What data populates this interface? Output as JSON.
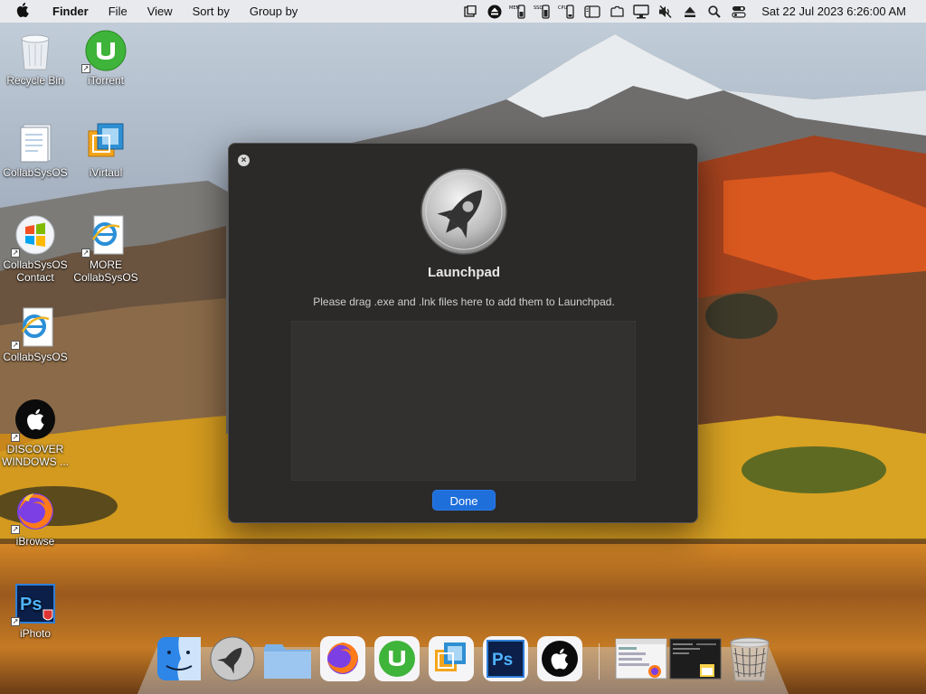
{
  "menubar": {
    "app_name": "Finder",
    "menus": [
      "File",
      "View",
      "Sort by",
      "Group by"
    ],
    "status_icons": [
      "task-manager-icon",
      "eject-disk-icon",
      "ram-meter-icon",
      "ssd-meter-icon",
      "cpu-meter-icon",
      "sidebar-icon",
      "cloud-icon",
      "display-icon",
      "mute-icon",
      "eject-icon",
      "search-icon",
      "control-center-icon"
    ],
    "status_labels": {
      "mem": "MEM",
      "ssd": "SSD",
      "cpu": "CPU"
    },
    "clock": "Sat 22 Jul 2023  6:26:00 AM"
  },
  "desktop": {
    "icons": [
      {
        "label": "Recycle Bin",
        "icon": "recycle-bin-icon"
      },
      {
        "label": "iTorrent",
        "icon": "utorrent-icon"
      },
      {
        "label": "CollabSysOS",
        "icon": "folder-doc-icon"
      },
      {
        "label": "iVirtaul",
        "icon": "virtual-machine-icon"
      },
      {
        "label": "CollabSysOS Contact",
        "icon": "windows-logo-icon"
      },
      {
        "label": "MORE CollabSysOS",
        "icon": "ie-document-icon"
      },
      {
        "label": "CollabSysOS",
        "icon": "ie-document-icon"
      },
      {
        "label": "DISCOVER WINDOWS ...",
        "icon": "apple-logo-icon"
      },
      {
        "label": "iBrowse",
        "icon": "firefox-icon"
      },
      {
        "label": "iPhoto",
        "icon": "photoshop-icon"
      }
    ]
  },
  "dialog": {
    "title": "Launchpad",
    "message": "Please drag .exe and .lnk files here to add them to Launchpad.",
    "done_label": "Done"
  },
  "dock": {
    "items": [
      "finder-icon",
      "launchpad-icon",
      "folder-icon",
      "firefox-icon",
      "utorrent-icon",
      "virtual-machine-icon",
      "photoshop-icon",
      "apple-logo-icon",
      "window-thumbnail-icon",
      "terminal-thumbnail-icon",
      "trash-icon"
    ],
    "labels": {
      "photoshop": "Ps"
    }
  },
  "colors": {
    "accent": "#1f6fdb",
    "dialog_bg": "#2b2a29",
    "menubar_bg": "#ececee"
  }
}
